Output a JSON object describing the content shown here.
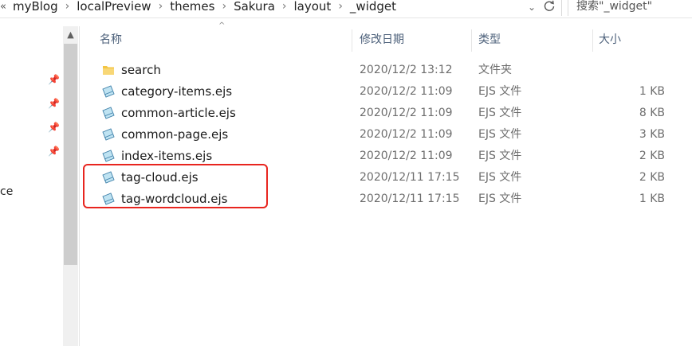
{
  "breadcrumb": {
    "back_chevron": "«",
    "segments": [
      "myBlog",
      "localPreview",
      "themes",
      "Sakura",
      "layout",
      "_widget"
    ],
    "separator": "›"
  },
  "search": {
    "placeholder": "搜索\"_widget\""
  },
  "nav": {
    "partial_label": "ce"
  },
  "columns": {
    "name": "名称",
    "date": "修改日期",
    "type": "类型",
    "size": "大小"
  },
  "files": [
    {
      "name": "search",
      "date": "2020/12/2 13:12",
      "type": "文件夹",
      "size": "",
      "icon": "folder-icon"
    },
    {
      "name": "category-items.ejs",
      "date": "2020/12/2 11:09",
      "type": "EJS 文件",
      "size": "1 KB",
      "icon": "file-icon"
    },
    {
      "name": "common-article.ejs",
      "date": "2020/12/2 11:09",
      "type": "EJS 文件",
      "size": "8 KB",
      "icon": "file-icon"
    },
    {
      "name": "common-page.ejs",
      "date": "2020/12/2 11:09",
      "type": "EJS 文件",
      "size": "3 KB",
      "icon": "file-icon"
    },
    {
      "name": "index-items.ejs",
      "date": "2020/12/2 11:09",
      "type": "EJS 文件",
      "size": "2 KB",
      "icon": "file-icon"
    },
    {
      "name": "tag-cloud.ejs",
      "date": "2020/12/11 17:15",
      "type": "EJS 文件",
      "size": "2 KB",
      "icon": "file-icon"
    },
    {
      "name": "tag-wordcloud.ejs",
      "date": "2020/12/11 17:15",
      "type": "EJS 文件",
      "size": "1 KB",
      "icon": "file-icon"
    }
  ],
  "colors": {
    "highlight": "#e8251f",
    "folder": "#f4c542",
    "header_text": "#4c607a"
  }
}
